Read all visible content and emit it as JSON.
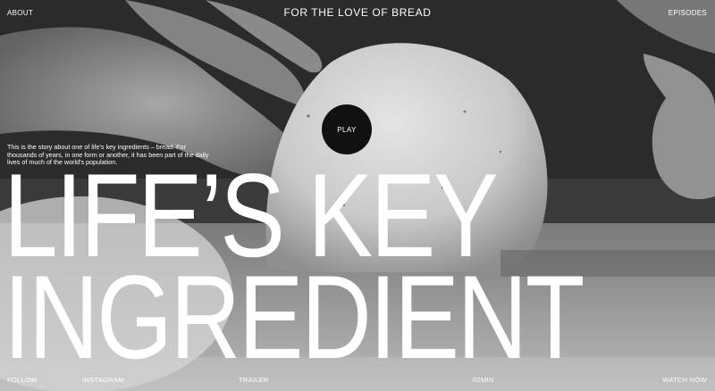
{
  "header": {
    "about_label": "ABOUT",
    "logo_text": "FOR THE LOVE OF BREAD",
    "episodes_label": "EPISODES"
  },
  "hero": {
    "intro_text": "This is the story about one of life's key ingredients – bread. For thousands of years, in one form or another, it has been part of the daily lives of much of the world's population.",
    "play_label": "PLAY",
    "headline_line1": "LIFE’S KEY",
    "headline_line2": "INGREDIENT",
    "background_image": "black-and-white photo of hands shaping bread dough"
  },
  "footer": {
    "follow_label": "FOLLOW",
    "instagram_label": "INSTAGRAM",
    "trailer_label": "TRAILER",
    "duration": "02MIN",
    "watch_now_label": "WATCH NOW"
  },
  "colors": {
    "text": "#ffffff",
    "play_button": "#111111"
  }
}
